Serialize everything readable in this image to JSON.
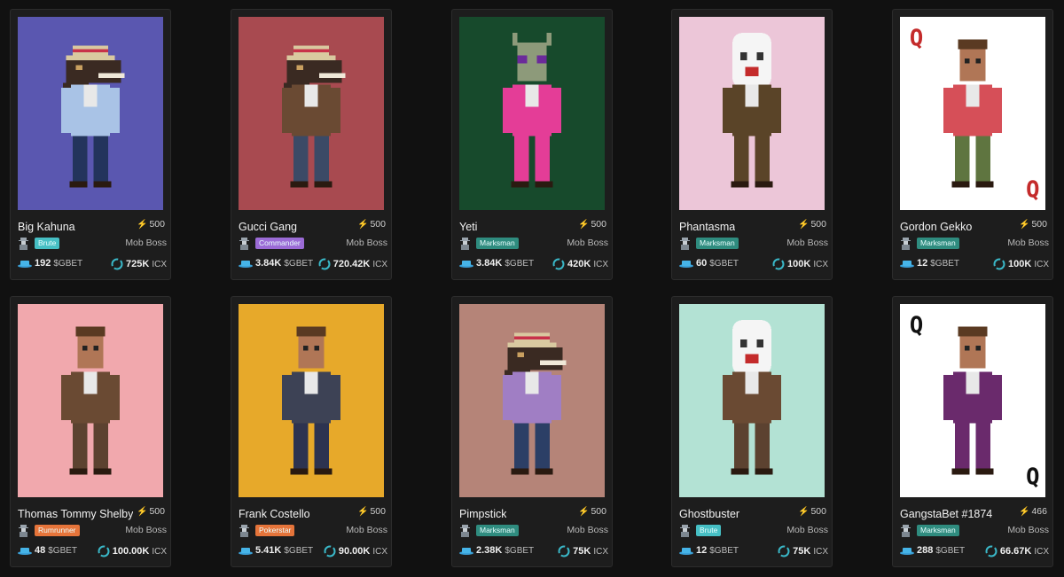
{
  "cards": [
    {
      "name": "Big Kahuna",
      "power": "500",
      "role": "Brute",
      "role_color": "#46bfc4",
      "rank": "Mob Boss",
      "gbet": "192",
      "gbet_unit": "$GBET",
      "icx": "725K",
      "icx_unit": "ICX",
      "bg": "#5a57b0",
      "character": "dino",
      "outfit": "#a9c3e6",
      "pants": "#23345c"
    },
    {
      "name": "Gucci Gang",
      "power": "500",
      "role": "Commander",
      "role_color": "#9b6bd6",
      "rank": "Mob Boss",
      "gbet": "3.84K",
      "gbet_unit": "$GBET",
      "icx": "720.42K",
      "icx_unit": "ICX",
      "bg": "#a84a50",
      "character": "dino",
      "outfit": "#6a4a33",
      "pants": "#3b4a66"
    },
    {
      "name": "Yeti",
      "power": "500",
      "role": "Marksman",
      "role_color": "#2f8c7f",
      "rank": "Mob Boss",
      "gbet": "3.84K",
      "gbet_unit": "$GBET",
      "icx": "420K",
      "icx_unit": "ICX",
      "bg": "#174a2c",
      "character": "alien",
      "outfit": "#e43d97",
      "pants": "#e43d97"
    },
    {
      "name": "Phantasma",
      "power": "500",
      "role": "Marksman",
      "role_color": "#2f8c7f",
      "rank": "Mob Boss",
      "gbet": "60",
      "gbet_unit": "$GBET",
      "icx": "100K",
      "icx_unit": "ICX",
      "bg": "#ecc6d8",
      "character": "ghost",
      "outfit": "#5a4428",
      "pants": "#5a4428"
    },
    {
      "name": "Gordon Gekko",
      "power": "500",
      "role": "Marksman",
      "role_color": "#2f8c7f",
      "rank": "Mob Boss",
      "gbet": "12",
      "gbet_unit": "$GBET",
      "icx": "100K",
      "icx_unit": "ICX",
      "bg": "#ffffff",
      "character": "card-human",
      "outfit": "#d64f58",
      "pants": "#5f7540"
    },
    {
      "name": "Thomas Tommy Shelby",
      "power": "500",
      "role": "Rumrunner",
      "role_color": "#e5743a",
      "rank": "Mob Boss",
      "gbet": "48",
      "gbet_unit": "$GBET",
      "icx": "100.00K",
      "icx_unit": "ICX",
      "bg": "#f1a8ad",
      "character": "human",
      "outfit": "#6a4a33",
      "pants": "#5c4230"
    },
    {
      "name": "Frank Costello",
      "power": "500",
      "role": "Pokerstar",
      "role_color": "#e5743a",
      "rank": "Mob Boss",
      "gbet": "5.41K",
      "gbet_unit": "$GBET",
      "icx": "90.00K",
      "icx_unit": "ICX",
      "bg": "#e7a92a",
      "character": "human",
      "outfit": "#3d4255",
      "pants": "#2d3350"
    },
    {
      "name": "Pimpstick",
      "power": "500",
      "role": "Marksman",
      "role_color": "#2f8c7f",
      "rank": "Mob Boss",
      "gbet": "2.38K",
      "gbet_unit": "$GBET",
      "icx": "75K",
      "icx_unit": "ICX",
      "bg": "#b58478",
      "character": "dino",
      "outfit": "#a07ec4",
      "pants": "#2c3f66"
    },
    {
      "name": "Ghostbuster",
      "power": "500",
      "role": "Brute",
      "role_color": "#46bfc4",
      "rank": "Mob Boss",
      "gbet": "12",
      "gbet_unit": "$GBET",
      "icx": "75K",
      "icx_unit": "ICX",
      "bg": "#b3e2d4",
      "character": "ghost",
      "outfit": "#6a4a33",
      "pants": "#5c4230"
    },
    {
      "name": "GangstaBet #1874",
      "power": "466",
      "role": "Marksman",
      "role_color": "#2f8c7f",
      "rank": "Mob Boss",
      "gbet": "288",
      "gbet_unit": "$GBET",
      "icx": "66.67K",
      "icx_unit": "ICX",
      "bg": "#ffffff",
      "character": "card-human",
      "outfit": "#6a2a6c",
      "pants": "#6a2a6c"
    }
  ]
}
